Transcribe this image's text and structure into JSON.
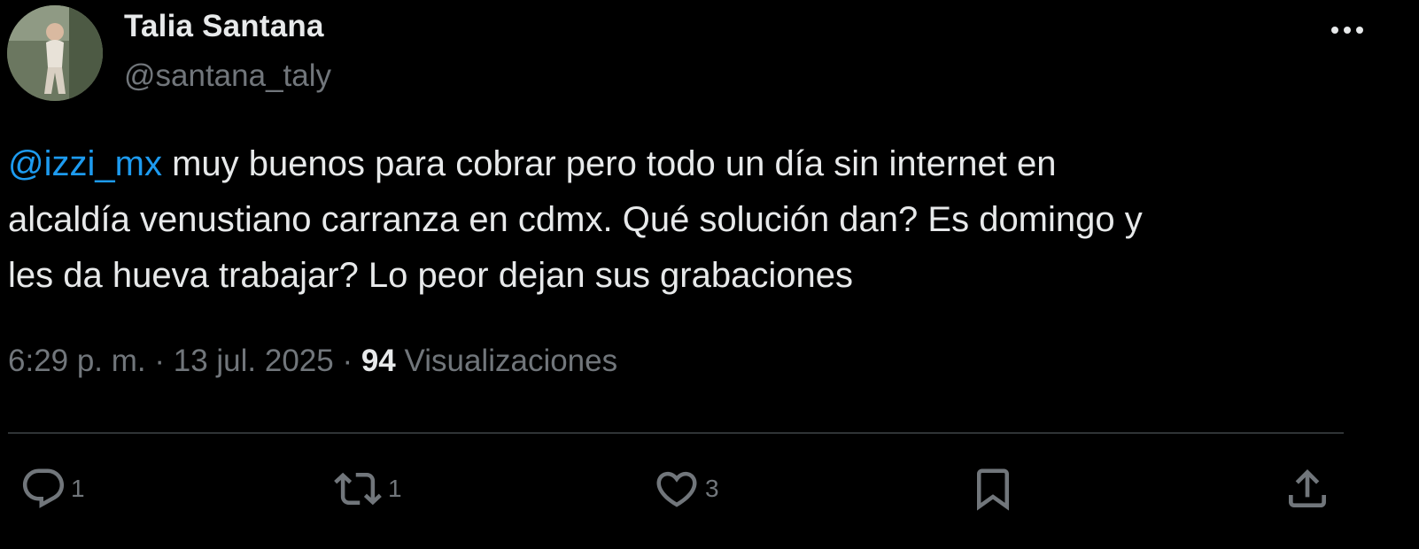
{
  "author": {
    "name": "Talia Santana",
    "handle": "@santana_taly",
    "avatar_icon": "profile-photo"
  },
  "header": {
    "more_icon": "more-horizontal-icon"
  },
  "tweet": {
    "mention": "@izzi_mx",
    "text": " muy buenos para cobrar pero todo un día sin internet en\nalcaldía venustiano carranza en cdmx. Qué solución dan? Es domingo y\nles da hueva trabajar? Lo peor dejan sus grabaciones",
    "mention_color": "#1d9bf0"
  },
  "meta": {
    "time": "6:29 p. m.",
    "separator": " · ",
    "date": "13 jul. 2025",
    "views_count": "94",
    "views_label": " Visualizaciones"
  },
  "actions": {
    "reply": {
      "icon": "reply-icon",
      "count": "1"
    },
    "repost": {
      "icon": "repost-icon",
      "count": "1"
    },
    "like": {
      "icon": "heart-icon",
      "count": "3"
    },
    "bookmark": {
      "icon": "bookmark-icon"
    },
    "share": {
      "icon": "share-icon"
    }
  },
  "colors": {
    "background": "#000000",
    "text_primary": "#e7e9ea",
    "text_secondary": "#71767b",
    "divider": "#2f3336",
    "accent": "#1d9bf0"
  }
}
